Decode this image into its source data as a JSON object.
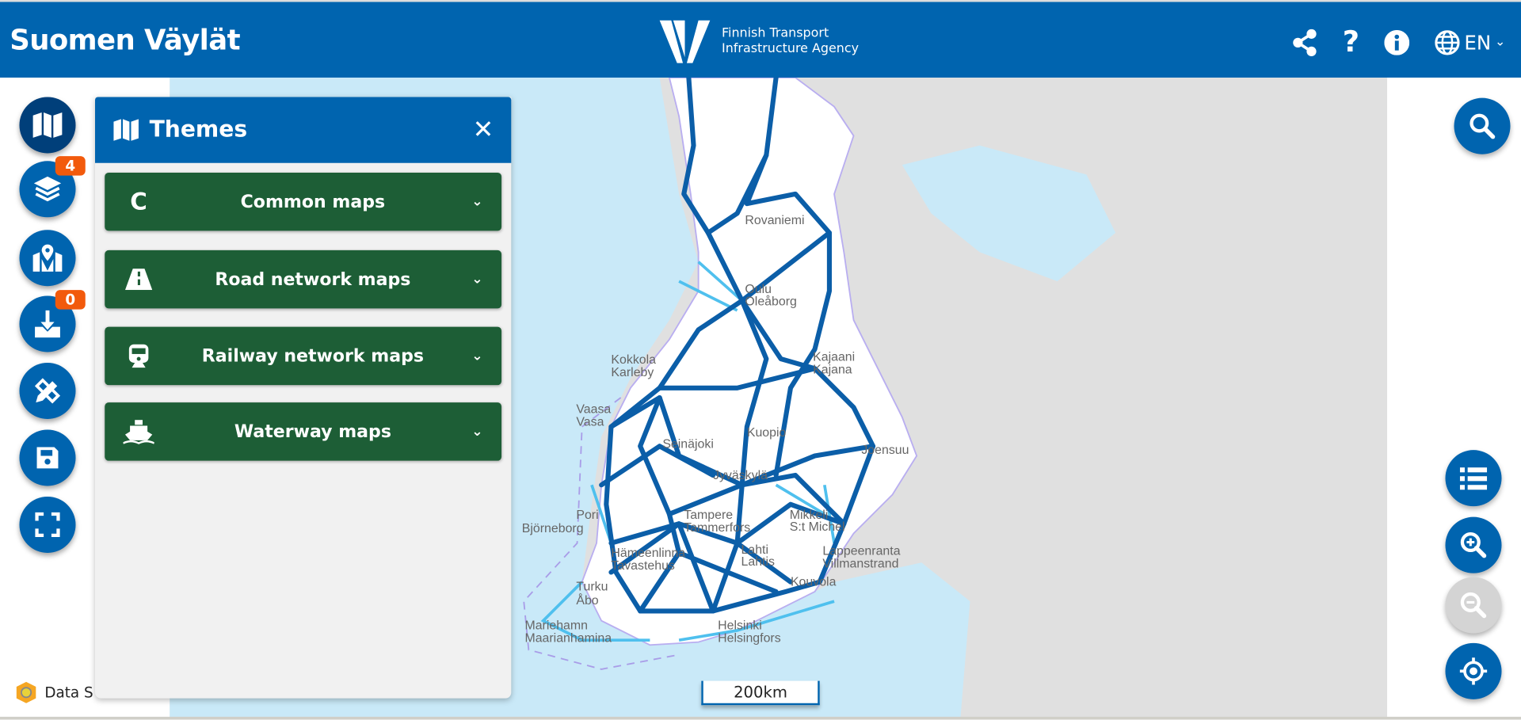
{
  "header": {
    "title": "Suomen Väylät",
    "agency_line1": "Finnish Transport",
    "agency_line2": "Infrastructure Agency",
    "language": "EN",
    "icons": [
      "share-icon",
      "help-icon",
      "info-icon",
      "globe-icon"
    ],
    "color": "#0064af"
  },
  "left_toolbar": {
    "items": [
      {
        "name": "themes",
        "icon": "map-icon"
      },
      {
        "name": "layers",
        "icon": "layers-icon",
        "badge": "4"
      },
      {
        "name": "map-markers",
        "icon": "map-marker-icon"
      },
      {
        "name": "download",
        "icon": "download-icon",
        "badge": "0"
      },
      {
        "name": "draw-measure",
        "icon": "pencil-ruler-icon"
      },
      {
        "name": "save",
        "icon": "save-icon"
      },
      {
        "name": "fullscreen",
        "icon": "expand-icon"
      }
    ],
    "badge_color": "#f25a0c"
  },
  "themes_panel": {
    "title": "Themes",
    "items": [
      {
        "label": "Common maps",
        "icon_text": "C"
      },
      {
        "label": "Road network maps",
        "icon": "road-icon"
      },
      {
        "label": "Railway network maps",
        "icon": "train-icon"
      },
      {
        "label": "Waterway maps",
        "icon": "ship-icon"
      }
    ],
    "item_color": "#1d5e36"
  },
  "map": {
    "scale": "200km",
    "data_source": "Data S",
    "cities": [
      [
        "Rovaniemi"
      ],
      [
        "Oulu",
        "Oleåborg"
      ],
      [
        "Kokkola",
        "Karleby"
      ],
      [
        "Kajaani",
        "Kajana"
      ],
      [
        "Vaasa",
        "Vasa"
      ],
      [
        "Kuopio"
      ],
      [
        "Seinäjoki"
      ],
      [
        "Joensuu"
      ],
      [
        "Jyväskylä"
      ],
      [
        "Pori",
        "Björneborg"
      ],
      [
        "Tampere",
        "Tammerfors"
      ],
      [
        "Mikkeli",
        "S:t Michel"
      ],
      [
        "Hämeenlinna",
        "Tavastehus"
      ],
      [
        "Lahti",
        "Lahtis"
      ],
      [
        "Lappeenranta",
        "Villmanstrand"
      ],
      [
        "Kouvola"
      ],
      [
        "Turku",
        "Åbo"
      ],
      [
        "Mariehamn",
        "Maarianhamina"
      ],
      [
        "Helsinki",
        "Helsingfors"
      ]
    ]
  },
  "right_toolbar": {
    "items": [
      "search-icon",
      "list-icon",
      "zoom-in-icon",
      "zoom-out-icon",
      "locate-icon"
    ]
  }
}
